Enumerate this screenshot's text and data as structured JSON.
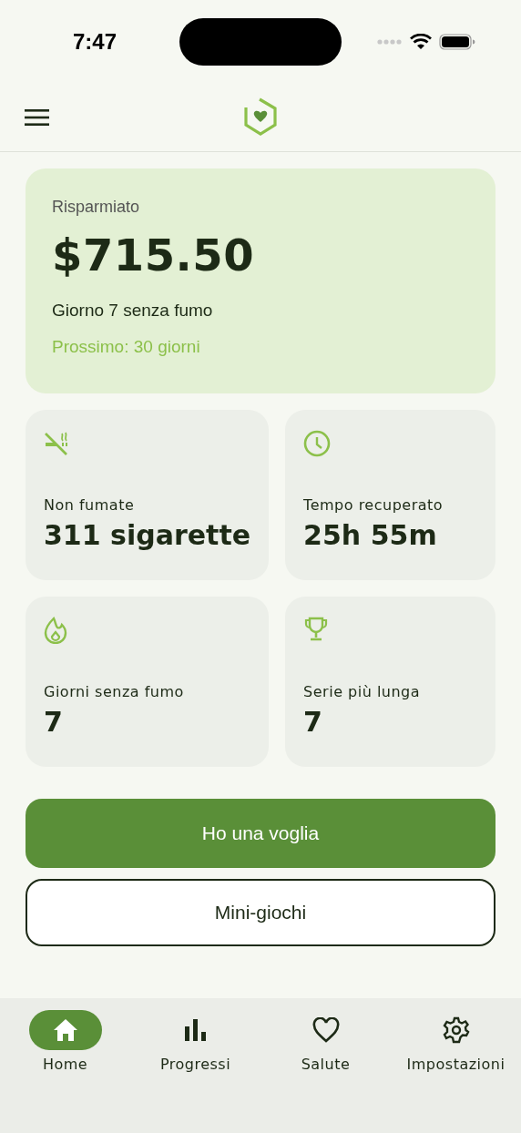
{
  "status_bar": {
    "time": "7:47"
  },
  "summary": {
    "label": "Risparmiato",
    "amount": "$715.50",
    "day": "Giorno 7 senza fumo",
    "next": "Prossimo: 30 giorni"
  },
  "stats": [
    {
      "kind": "no-smoking",
      "label": "Non fumate",
      "value": "311 sigarette"
    },
    {
      "kind": "clock",
      "label": "Tempo recuperato",
      "value": "25h 55m"
    },
    {
      "kind": "flame",
      "label": "Giorni senza fumo",
      "value": "7"
    },
    {
      "kind": "trophy",
      "label": "Serie più lunga",
      "value": "7"
    }
  ],
  "buttons": [
    {
      "kind": "primary",
      "label": "Ho una voglia"
    },
    {
      "kind": "outline",
      "label": "Mini-giochi"
    }
  ],
  "nav": [
    {
      "kind": "home",
      "label": "Home",
      "selected": true
    },
    {
      "kind": "chart",
      "label": "Progressi",
      "selected": false
    },
    {
      "kind": "heart",
      "label": "Salute",
      "selected": false
    },
    {
      "kind": "gear",
      "label": "Impostazioni",
      "selected": false
    }
  ]
}
